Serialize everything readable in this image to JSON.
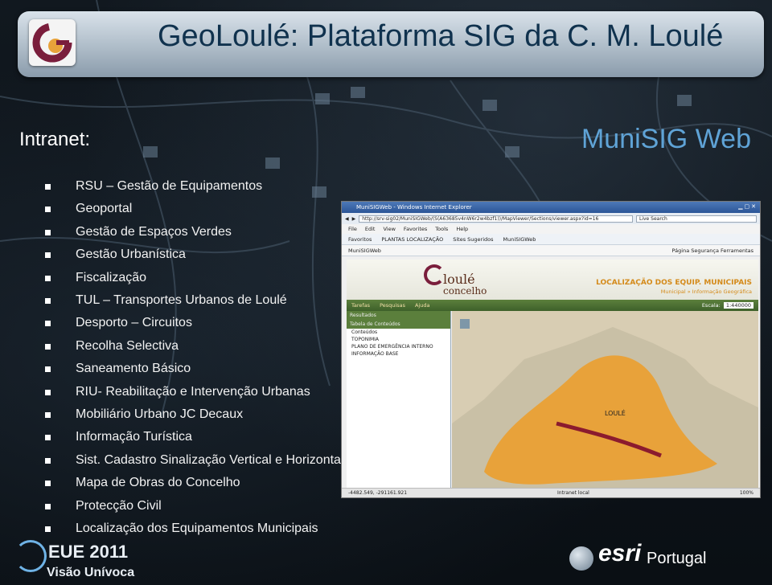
{
  "title": "GeoLoulé: Plataforma SIG da C. M. Loulé",
  "intranet_label": "Intranet:",
  "munisig_label": "MuniSIG Web",
  "items": [
    "RSU – Gestão de Equipamentos",
    "Geoportal",
    "Gestão de Espaços Verdes",
    "Gestão Urbanística",
    "Fiscalização",
    "TUL – Transportes Urbanos de Loulé",
    "Desporto – Circuitos",
    "Recolha Selectiva",
    "Saneamento Básico",
    "RIU- Reabilitação e Intervenção Urbanas",
    "Mobiliário Urbano JC Decaux",
    "Informação Turística",
    "Sist. Cadastro  Sinalização Vertical e Horizontal de Loulé",
    "Mapa de Obras do Concelho",
    "Protecção Civil",
    "Localização dos Equipamentos Municipais"
  ],
  "screenshot": {
    "window_title": "MuniSIGWeb - Windows Internet Explorer",
    "address": "http://srv-sig02/MuniSIGWeb/(S(A63685v4nW6r2w4bzf1))/MapViewer/Sections/viewer.aspx?id=16",
    "search_placeholder": "Live Search",
    "menu": [
      "File",
      "Edit",
      "View",
      "Favorites",
      "Tools",
      "Help"
    ],
    "favorites": [
      "Favoritos",
      "PLANTAS LOCALIZAÇÃO",
      "Sites Sugeridos",
      "MuniSIGWeb"
    ],
    "tab_label": "MuniSIGWeb",
    "tab_tools": "Página  Segurança  Ferramentas",
    "brand_main": "loulé",
    "brand_sub": "concelho",
    "header_title": "LOCALIZAÇÃO DOS EQUIP. MUNICIPAIS",
    "header_sub": "Municipal » Informação Geográfica",
    "toolbar": [
      "Tarefas",
      "Pesquisas",
      "Ajuda"
    ],
    "scale_label": "Escala:",
    "scale_value": "1:440000",
    "panel_header": "Resultados",
    "toc_header": "Tabela de Conteúdos",
    "toc_items": [
      "Conteúdos",
      "TOPONIMIA",
      "PLANO DE EMERGÊNCIA INTERNO",
      "INFORMAÇÃO BASE"
    ],
    "map_label": "LOULÉ",
    "coords": "-4482.549, -291161.921",
    "status_zone": "Intranet local",
    "status_zoom": "100%"
  },
  "footer": {
    "event_name": "EUE 2011",
    "event_sub": "Visão Unívoca",
    "esri_word": "esri",
    "esri_country": "Portugal"
  },
  "colors": {
    "title_text": "#10324e",
    "munisig": "#5fa3d6",
    "map_land": "#e8a23a",
    "map_route": "#8b1b2e"
  }
}
